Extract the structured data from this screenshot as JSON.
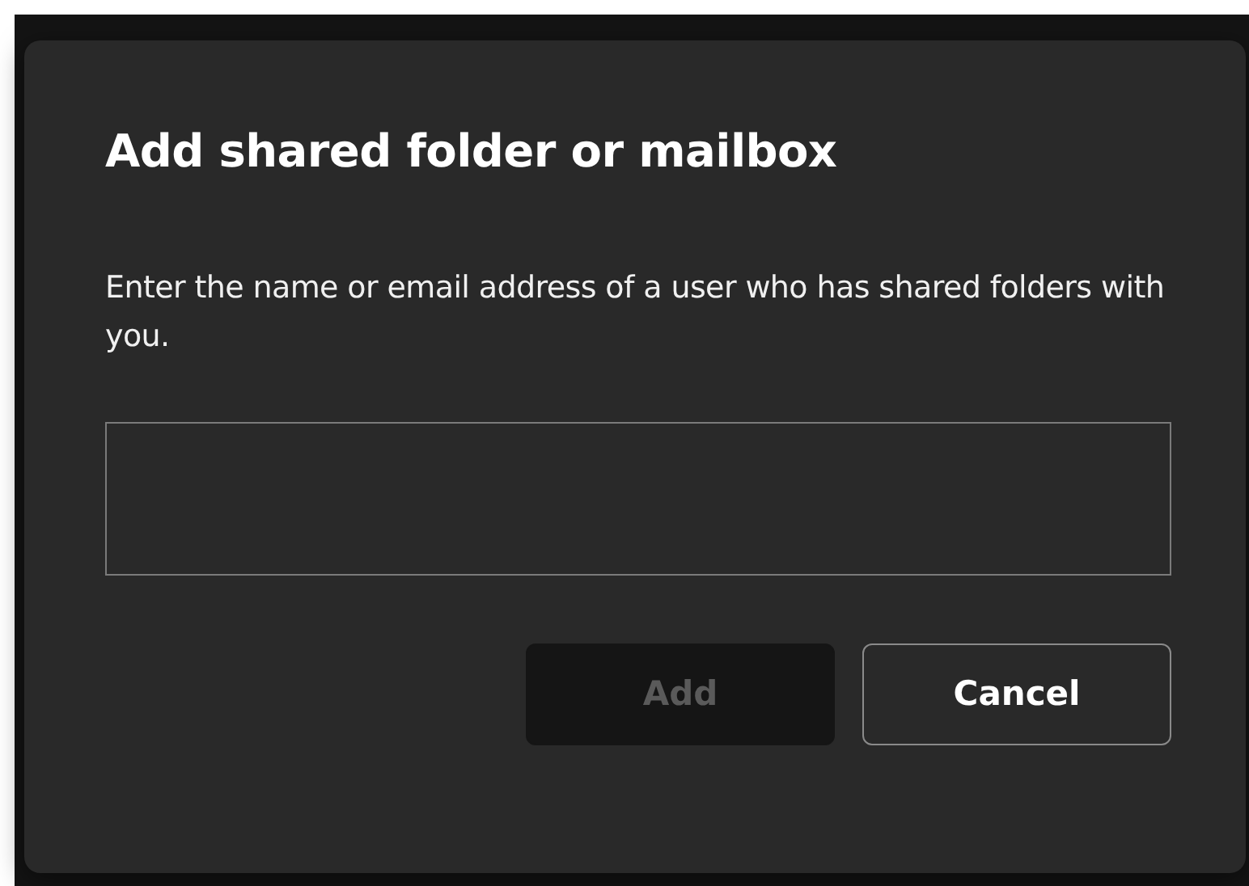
{
  "dialog": {
    "title": "Add shared folder or mailbox",
    "description": "Enter the name or email address of a user who has shared folders with you.",
    "buttons": [
      {
        "label": "Add",
        "disabled": true
      },
      {
        "label": "Cancel",
        "disabled": false
      }
    ]
  }
}
